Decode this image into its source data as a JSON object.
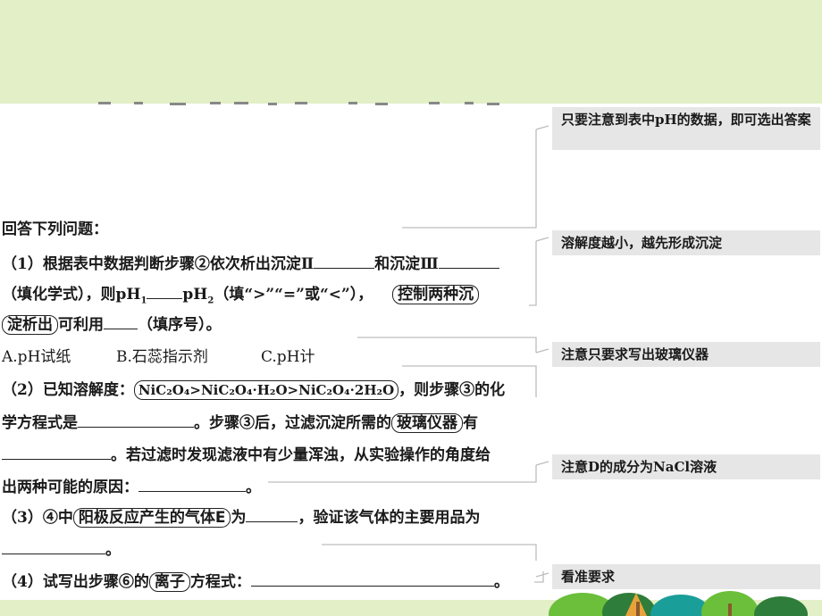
{
  "lines": {
    "intro": "回答下列问题：",
    "q1_a": "（1）根据表中数据判断步骤②依次析出沉淀Ⅱ",
    "q1_b": "和沉淀Ⅲ",
    "q1_c": "（填化学式），则pH",
    "q1_c_sub1": "1",
    "q1_d": "pH",
    "q1_d_sub2": "2",
    "q1_e": "（填“>”“=”或“<”），",
    "q1_box": "控制两种沉",
    "q1_box2": "淀析出",
    "q1_f": "可利用",
    "q1_g": "（填序号）。",
    "opt_a": "A.pH试纸",
    "opt_b": "B.石蕊指示剂",
    "opt_c": "C.pH计",
    "q2_a": "（2）已知溶解度：",
    "q2_formula": "NiC₂O₄>NiC₂O₄·H₂O>NiC₂O₄·2H₂O",
    "q2_b": "，则步骤③的化",
    "q2_c": "学方程式是",
    "q2_d": "。步骤③后，过滤沉淀所需的",
    "q2_box": "玻璃仪器",
    "q2_e": "有",
    "q2_f": "。若过滤时发现滤液中有少量浑浊，从实验操作的角度给",
    "q2_g": "出两种可能的原因：",
    "q2_h": "。",
    "q3_a": "（3）④中",
    "q3_box": "阳极反应产生的气体E",
    "q3_b": "为",
    "q3_c": "，验证该气体的主要用品为",
    "q3_d": "。",
    "q4_a": "（4）试写出步骤⑥的",
    "q4_box": "离子",
    "q4_b": "方程式：",
    "q4_c": "。"
  },
  "notes": [
    "只要注意到表中pH的数据，即可选出答案",
    "溶解度越小，越先形成沉淀",
    "注意只要求写出玻璃仪器",
    "注意D的成分为NaCl溶液",
    "看准要求"
  ],
  "colors": {
    "band": "#e2efc7",
    "note_bg": "#e6e6e6",
    "connector": "#bdbdbd",
    "tree_green": "#6bbf3a",
    "tree_dark": "#2f7d3a",
    "tree_orange": "#e9a23b",
    "tree_teal": "#1a9e9a"
  }
}
